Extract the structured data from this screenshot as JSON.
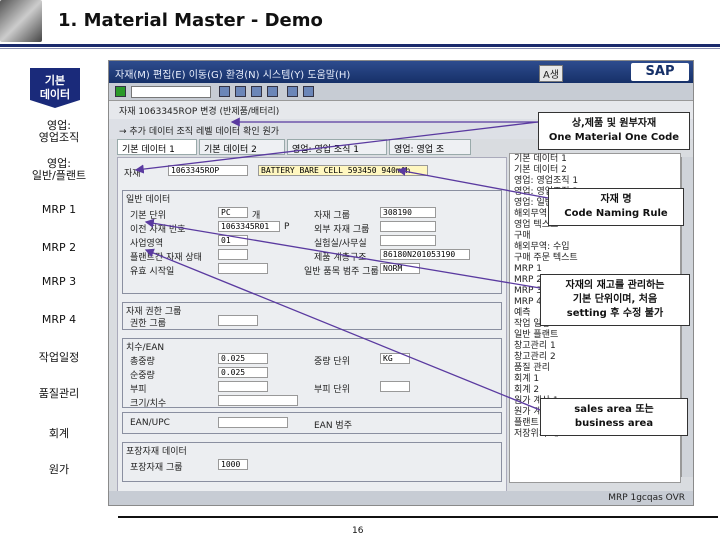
{
  "slide": {
    "title": "1. Material Master - Demo",
    "page_number": "16"
  },
  "nav": {
    "active": "기본\n데이터",
    "items": [
      "영업:\n영업조직",
      "영업:\n일반/플랜트",
      "MRP 1",
      "MRP 2",
      "MRP 3",
      "MRP 4",
      "작업일정",
      "품질관리",
      "회계",
      "원가"
    ]
  },
  "sap": {
    "menubar": "자재(M)  편집(E)  이동(G)  환경(N)  시스템(Y)  도움말(H)",
    "session_label": "A생",
    "header_title": "자재 1063345ROP 변경 (반제품/배터리)",
    "app_toolbar": "→  추가 데이터   조직 레벨   데이터 확인   원가",
    "tabs": [
      "기본 데이터 1",
      "기본 데이터 2",
      "영업: 영업 조직 1",
      "영업: 영업 조"
    ],
    "material_label": "자재",
    "material_no": "1063345ROP",
    "material_desc": "BATTERY BARE CELL 593450 940mAh",
    "group_general": "일반 데이터",
    "field_base_uom": "기본 단위",
    "val_base_uom": "PC",
    "val_uom_text": "개",
    "field_old_material": "이전 자재 번호",
    "val_old_material": "1063345R01",
    "val_old_extra": "P",
    "field_division": "사업영역",
    "val_division": "01",
    "field_x_plant_status": "플랜트간 자재 상태",
    "field_valid_from": "유효 시작일",
    "field_mat_group": "자재 그룹",
    "val_mat_group": "308190",
    "field_ext_mat_group": "외부 자재 그룹",
    "field_lab": "실험실/사무실",
    "field_prod_hier": "제품 계층구조",
    "val_prod_hier": "86180N201053190",
    "field_gen_item_cat": "일반 품목 범주 그룹",
    "val_gen_item_cat": "NORM",
    "group_mat_auth": "자재 권한 그룹",
    "field_auth_group": "권한 그룹",
    "group_dims": "치수/EAN",
    "field_gross_wt": "총중량",
    "val_gross_wt": "0.025",
    "field_net_wt": "순중량",
    "val_net_wt": "0.025",
    "field_volume": "부피",
    "field_size": "크기/치수",
    "field_ean": "EAN/UPC",
    "field_wt_unit": "중량 단위",
    "val_wt_unit": "KG",
    "field_vol_unit": "부피 단위",
    "field_ean_cat": "EAN 범주",
    "group_packaging": "포장자재 데이터",
    "field_pack_group": "포장자재 그룹",
    "val_pack_group": "1000",
    "right_list": [
      "기본 데이터 1",
      "기본 데이터 2",
      "영업: 영업조직 1",
      "영업: 영업조직 2",
      "영업: 일반/플랜트",
      "해외무역: 수출",
      "영업 텍스트",
      "구매",
      "해외무역: 수입",
      "구매 주문 텍스트",
      "MRP 1",
      "MRP 2",
      "MRP 3",
      "MRP 4",
      "예측",
      "작업 일정",
      "일반 플랜트",
      "창고관리 1",
      "창고관리 2",
      "품질 관리",
      "회계 1",
      "회계 2",
      "원가 계산 1",
      "원가 계산 2",
      "플랜트 재고",
      "저장위치 재고"
    ],
    "status": "MRP  1gcqas  OVR"
  },
  "callouts": [
    "상,제품 및 원부자재\nOne Material One Code",
    "자재 명\nCode Naming Rule",
    "자재의 재고를 관리하는\n기본 단위이며, 처음\nsetting 후 수정 불가",
    "sales area 또는\nbusiness area"
  ],
  "colors": {
    "nav_active_bg": "#1a2a7a",
    "sap_titlebar": "#163068",
    "callout_arrow": "#5a3aa0"
  }
}
